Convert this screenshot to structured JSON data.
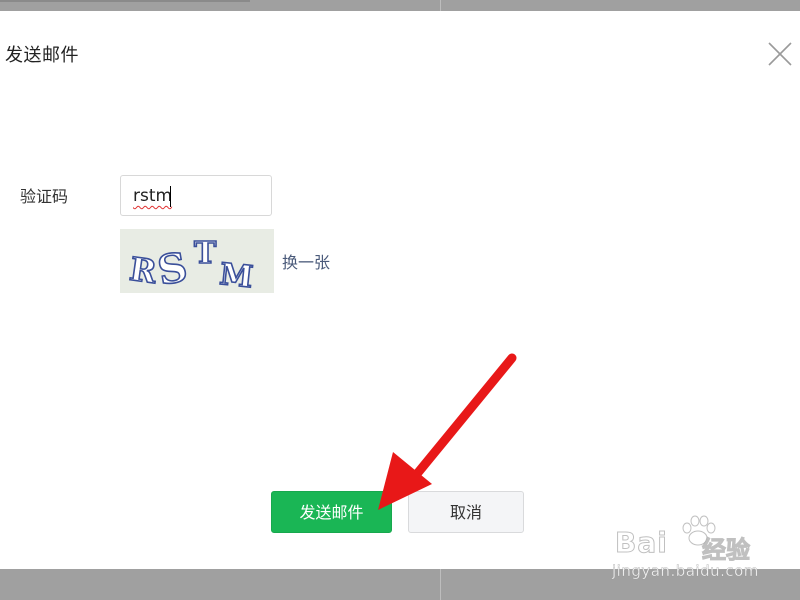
{
  "dialog": {
    "title": "发送邮件",
    "close_icon": "close-icon"
  },
  "form": {
    "captcha_label": "验证码",
    "captcha_value": "rstm",
    "captcha_image_text": "RSTM",
    "refresh_label": "换一张"
  },
  "actions": {
    "send_label": "发送邮件",
    "cancel_label": "取消"
  },
  "watermark": {
    "brand": "Bai",
    "brand_cn": "经验",
    "url": "jingyan.baidu.com"
  },
  "colors": {
    "primary": "#1ab655",
    "arrow": "#e81818",
    "link": "#4a5a7a"
  }
}
